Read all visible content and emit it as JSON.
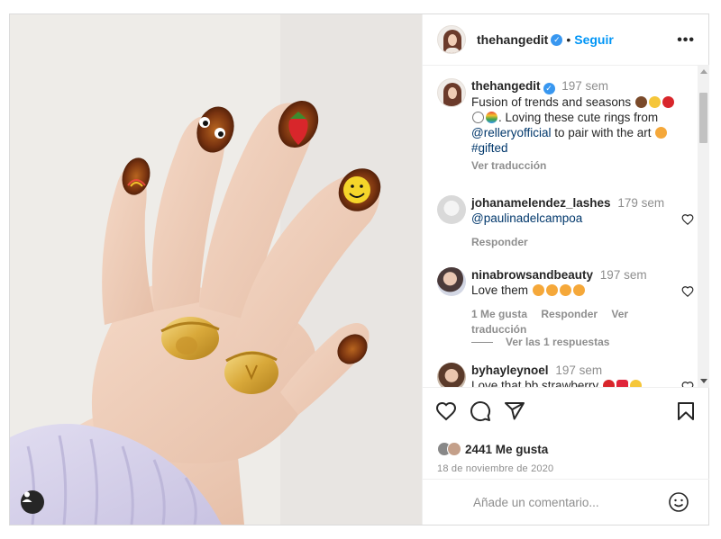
{
  "header": {
    "username": "thehangedit",
    "separator": "•",
    "follow_label": "Seguir",
    "more_label": "•••"
  },
  "caption": {
    "username": "thehangedit",
    "time": "197 sem",
    "text_part1": "Fusion of trends and seasons",
    "text_part2": ". Loving these cute rings from",
    "mention": "@relleryofficial",
    "text_part3": "to pair with the art",
    "hashtag": "#gifted",
    "translate_label": "Ver traducción"
  },
  "comments": [
    {
      "username": "johanamelendez_lashes",
      "time": "179 sem",
      "text": "@paulinadelcampoa",
      "reply_label": "Responder"
    },
    {
      "username": "ninabrowsandbeauty",
      "time": "197 sem",
      "text": "Love them",
      "likes_label": "1 Me gusta",
      "reply_label": "Responder",
      "translate_label": "Ver traducción",
      "view_replies_label": "Ver las 1 respuestas"
    },
    {
      "username": "byhayleynoel",
      "time": "197 sem",
      "text": "Love that bb strawberry"
    }
  ],
  "actions": {
    "likes_text": "2441 Me gusta",
    "date": "18 de noviembre de 2020"
  },
  "add_comment": {
    "placeholder": "Añade un comentario..."
  },
  "colors": {
    "link_blue": "#0095f6",
    "verified_blue": "#3897f0",
    "muted_gray": "#8e8e8e",
    "text_dark": "#262626"
  },
  "icons": [
    "user-tag-icon",
    "verified-icon",
    "more-options-icon",
    "heart-icon",
    "comment-icon",
    "share-icon",
    "bookmark-icon",
    "emoji-icon"
  ]
}
